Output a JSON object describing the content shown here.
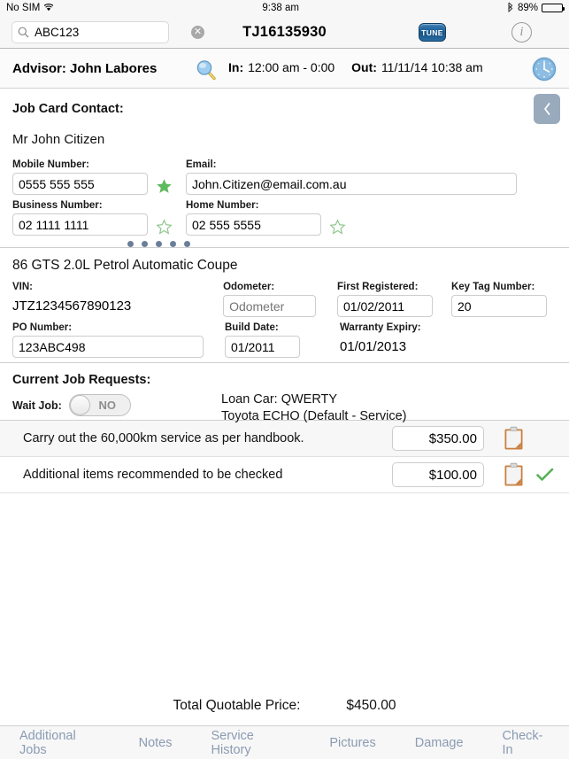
{
  "statusbar": {
    "carrier": "No SIM",
    "wifi_icon": "wifi-icon",
    "time": "9:38 am",
    "bluetooth_icon": "bluetooth-icon",
    "battery_percent": "89%",
    "battery_level": 89
  },
  "navbar": {
    "search": {
      "value": "ABC123",
      "placeholder": "Search",
      "icon": "search-icon",
      "clear_icon": "clear-icon"
    },
    "title": "TJ16135930",
    "tune_label": "TUNE",
    "info_label": "i"
  },
  "advisor": {
    "name_label": "Advisor: John Labores",
    "magnifier_icon": "magnifier-icon",
    "in_label": "In:",
    "in_value": "12:00 am - 0:00",
    "out_label": "Out:",
    "out_value": "11/11/14 10:38 am",
    "clock_icon": "clock-icon"
  },
  "contact": {
    "section_title": "Job Card Contact:",
    "collapse_icon": "chevron-left-icon",
    "customer_name": "Mr John Citizen",
    "fields": [
      {
        "label": "Mobile Number:",
        "value": "0555 555 555",
        "star": "filled"
      },
      {
        "label": "Email:",
        "value": "John.Citizen@email.com.au",
        "star": "none"
      },
      {
        "label": "Business Number:",
        "value": "02 1111 1111",
        "star": "outline"
      },
      {
        "label": "Home Number:",
        "value": "02 555 5555",
        "star": "outline"
      }
    ],
    "page_dots": 5,
    "dot_color": "#6b7e99"
  },
  "vehicle": {
    "title": "86 GTS 2.0L Petrol Automatic Coupe",
    "vin_label": "VIN:",
    "vin_value": "JTZ1234567890123",
    "odometer_label": "Odometer:",
    "odometer_placeholder": "Odometer",
    "odometer_value": "",
    "first_registered_label": "First Registered:",
    "first_registered_value": "01/02/2011",
    "key_tag_label": "Key Tag Number:",
    "key_tag_value": "20",
    "po_label": "PO Number:",
    "po_value": "123ABC498",
    "build_date_label": "Build Date:",
    "build_date_value": "01/2011",
    "warranty_label": "Warranty Expiry:",
    "warranty_value": "01/01/2013"
  },
  "job_requests": {
    "section_title": "Current Job Requests:",
    "wait_job_label": "Wait Job:",
    "wait_job_state": "NO",
    "loan_car_line1": "Loan Car: QWERTY",
    "loan_car_line2": "Toyota ECHO (Default - Service)",
    "rows": [
      {
        "description": "Carry out the 60,000km service as per handbook.",
        "price": "$350.00",
        "clipboard_icon": "clipboard-icon",
        "checked": false
      },
      {
        "description": "Additional items recommended to be checked",
        "price": "$100.00",
        "clipboard_icon": "clipboard-icon",
        "checked": true,
        "check_icon": "green-check-icon"
      }
    ]
  },
  "total": {
    "label": "Total Quotable Price:",
    "value": "$450.00"
  },
  "tabbar": {
    "tabs": [
      {
        "label": "Additional Jobs"
      },
      {
        "label": "Notes"
      },
      {
        "label": "Service History"
      },
      {
        "label": "Pictures"
      },
      {
        "label": "Damage"
      },
      {
        "label": "Check-In"
      }
    ],
    "tab_color": "#8a9bb2"
  },
  "colors": {
    "accent_green": "#5cb85c",
    "star_filled": "#5fba5f",
    "star_outline": "#8bc48b",
    "collapse_bg": "#9aaabd",
    "tune_blue": "#1c5d95"
  }
}
